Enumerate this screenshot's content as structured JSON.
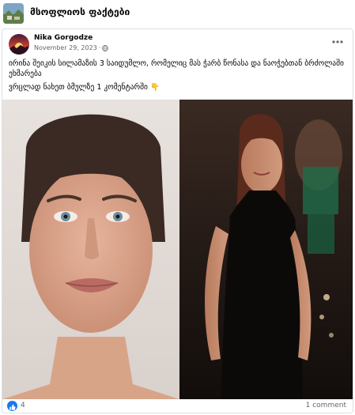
{
  "group": {
    "title": "მსოფლიოს ფაქტები",
    "avatar_icon": "group-landscape-avatar"
  },
  "post": {
    "author": "Nika Gorgodze",
    "date": "November 29, 2023",
    "separator": "·",
    "privacy_icon": "globe-icon",
    "text_line1": "ირინა შეიკის სილამაზის 3 საიდუმლო, რომელიც მას ჭარბ წონასა და ნაოჭებთან ბრძოლაში ეხმარება",
    "text_line2": "ვრცლად ნახეთ ბმულზე 1 კომენტარში",
    "pointer_emoji": "👇",
    "more_icon": "more-horizontal-icon"
  },
  "reactions": {
    "count": "4",
    "icon": "like-icon"
  },
  "comments": {
    "label": "1 comment"
  },
  "colors": {
    "like_blue": "#1877f2",
    "meta_gray": "#65676b",
    "text": "#050505",
    "border": "#dddfe2"
  }
}
